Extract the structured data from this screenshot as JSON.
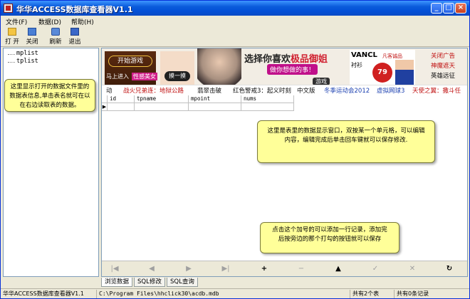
{
  "window": {
    "title": "华华ACCESS数据库查看器V1.1",
    "controls": {
      "minimize": "_",
      "maximize": "□",
      "close": "×"
    }
  },
  "menu": {
    "items": [
      {
        "label": "文件(F)"
      },
      {
        "label": "数据(D)"
      },
      {
        "label": "帮助(H)"
      }
    ]
  },
  "toolbar": {
    "items": [
      {
        "label": "打 开",
        "icon": "folder-open-icon"
      },
      {
        "label": "关闭",
        "icon": "close-db-icon"
      },
      {
        "label": "刷新",
        "icon": "refresh-icon"
      },
      {
        "label": "退出",
        "icon": "exit-icon"
      }
    ]
  },
  "tree": {
    "nodes": [
      {
        "label": "mplist"
      },
      {
        "label": "tplist"
      }
    ],
    "tip": "这里显示打开的数据文件里的\n数据表信息,单击表名就可在以\n在右边读取表的数据。"
  },
  "banner": {
    "game_title": "开始游戏",
    "game_sub": "马上进入",
    "game_tag": "性感美女",
    "hands_label": "摸一摸",
    "headline_prefix": "选择你喜欢",
    "headline_hot": "极品御姐",
    "sub": "做你想做的事！",
    "button": "游戏",
    "vancl_brand": "VANCL",
    "vancl_tag": "凡客诚品",
    "vancl_item": "衬衫",
    "vancl_price": "79",
    "right_links": [
      "关闭广告",
      "神魔遮天",
      "英雄远征"
    ]
  },
  "links": [
    {
      "label": "动",
      "color": "black"
    },
    {
      "label": "战火兄弟连：地狱公路",
      "color": "red"
    },
    {
      "label": "翡翠击破",
      "color": "black"
    },
    {
      "label": "红色警戒3：起义时刻",
      "color": "black"
    },
    {
      "label": "中文版",
      "color": "black"
    },
    {
      "label": "冬季运动会2012",
      "color": "blue"
    },
    {
      "label": "虚拟网球3",
      "color": "blue"
    },
    {
      "label": "天使之翼：撒斗任",
      "color": "red"
    }
  ],
  "grid": {
    "columns": [
      "id",
      "tpname",
      "mpoint",
      "nums"
    ],
    "current_row_marker": "▶"
  },
  "tips": {
    "grid": "这里是表里的数据显示窗口，双按某一个单元格，可以编辑\n内容，编辑完成后单击回车键就可以保存修改.",
    "add": "点击这个加号的可以添加一行记录，添加完\n后按旁边的那个打勾的按钮就可以保存"
  },
  "navigator": {
    "buttons": [
      {
        "name": "nav-first-button",
        "glyph": "|◀",
        "active": false
      },
      {
        "name": "nav-prior-button",
        "glyph": "◀",
        "active": false
      },
      {
        "name": "nav-next-button",
        "glyph": "▶",
        "active": false
      },
      {
        "name": "nav-last-button",
        "glyph": "▶|",
        "active": false
      },
      {
        "name": "nav-insert-button",
        "glyph": "+",
        "active": true
      },
      {
        "name": "nav-delete-button",
        "glyph": "−",
        "active": false
      },
      {
        "name": "nav-edit-button",
        "glyph": "▲",
        "active": true
      },
      {
        "name": "nav-post-button",
        "glyph": "✓",
        "active": false
      },
      {
        "name": "nav-cancel-button",
        "glyph": "✕",
        "active": false
      },
      {
        "name": "nav-refresh-button",
        "glyph": "↻",
        "active": true
      }
    ]
  },
  "tabs": [
    {
      "label": "浏览数据",
      "active": true
    },
    {
      "label": "SQL修改",
      "active": false
    },
    {
      "label": "SQL查询",
      "active": false
    }
  ],
  "status": {
    "app": "华华ACCESS数据库查看器V1.1",
    "path": "C:\\Program Files\\hhclick30\\acdb.mdb",
    "tables": "共有2个表",
    "records": "共有0条记录"
  }
}
